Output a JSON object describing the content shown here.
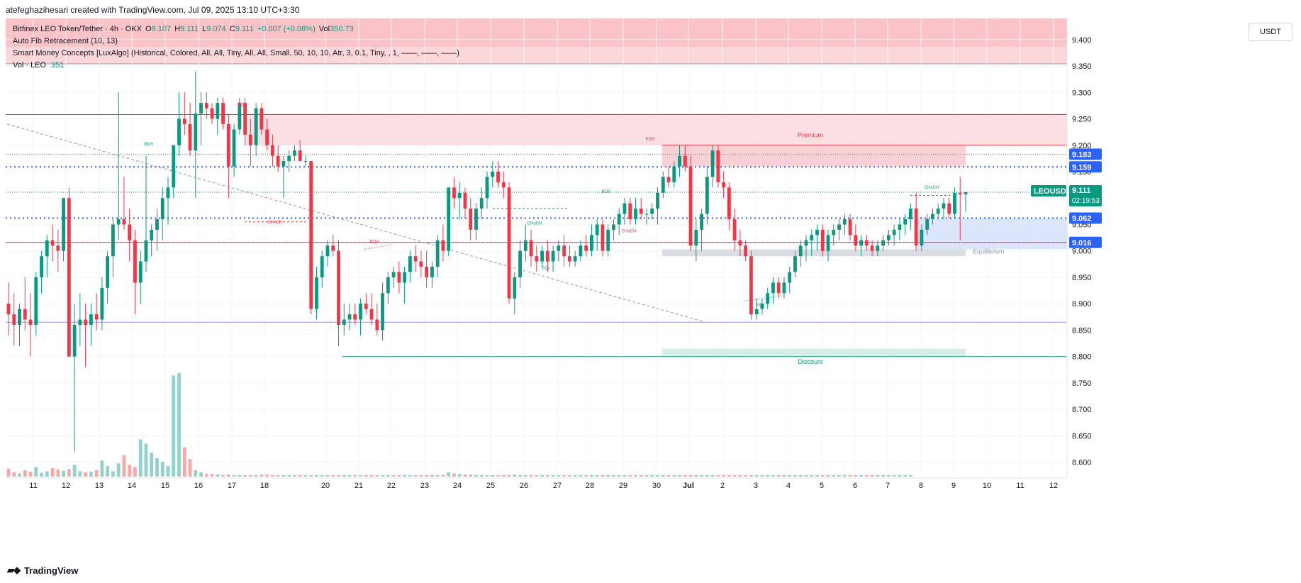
{
  "header": {
    "credit": "atefeghazihesari created with TradingView.com, Jul 09, 2025 13:10 UTC+3:30"
  },
  "legend": {
    "symbol_line": {
      "name": "Bitfinex LEO Token/Tether · 4h · OKX",
      "o_label": "O",
      "o": "9.107",
      "h_label": "H",
      "h": "9.111",
      "l_label": "L",
      "l": "9.074",
      "c_label": "C",
      "c": "9.111",
      "change": "+0.007 (+0.08%)",
      "vol_label": "Vol",
      "vol": "350.73"
    },
    "fib_line": "Auto Fib Retracement (10, 13)",
    "smc_line": "Smart Money Concepts [LuxAlgo] (Historical, Colored, All, All, Tiny, All, All, Small, 50, 10, 10, Atr, 3, 0.1, Tiny, , 1, ——, ——, ——)",
    "vol_line": {
      "label": "Vol · LEO",
      "value": "351"
    }
  },
  "currency_button": "USDT",
  "footer": {
    "logo": "TradingView"
  },
  "colors": {
    "up": "#089981",
    "down": "#f23645",
    "blue": "#2962ff",
    "grid": "#f0f3fa",
    "premium": "#fbdcdf",
    "discount": "#d6eee9"
  },
  "chart_data": {
    "type": "candlestick",
    "symbol": "LEOUSDT",
    "timeframe": "4h",
    "ylim": [
      8.57,
      9.44
    ],
    "y_ticks": [
      "9.400",
      "9.350",
      "9.300",
      "9.250",
      "9.200",
      "9.150",
      "9.100",
      "9.050",
      "9.000",
      "8.950",
      "8.900",
      "8.850",
      "8.800",
      "8.750",
      "8.700",
      "8.650",
      "8.600"
    ],
    "x_ticks": [
      "11",
      "12",
      "13",
      "14",
      "15",
      "16",
      "17",
      "18",
      "20",
      "21",
      "22",
      "23",
      "24",
      "25",
      "26",
      "27",
      "28",
      "29",
      "30",
      "Jul",
      "2",
      "3",
      "4",
      "5",
      "6",
      "7",
      "8",
      "9",
      "10",
      "11",
      "12"
    ],
    "price_labels": [
      {
        "text": "9.183",
        "value": 9.183,
        "color": "#2962ff"
      },
      {
        "text": "9.159",
        "value": 9.159,
        "color": "#2962ff"
      },
      {
        "text": "LEOUSDT",
        "value": 9.111,
        "color": "#089981"
      },
      {
        "text": "9.111",
        "value": 9.111,
        "color": "#089981"
      },
      {
        "text": "02:19:53",
        "value": 9.111,
        "color": "#089981"
      },
      {
        "text": "9.062",
        "value": 9.062,
        "color": "#2962ff"
      },
      {
        "text": "9.016",
        "value": 9.016,
        "color": "#2962ff"
      }
    ],
    "zones": [
      {
        "name": "Premium",
        "from": 9.2,
        "to": 9.26
      },
      {
        "name": "Equilibrium",
        "from": 8.99,
        "to": 9.003
      },
      {
        "name": "Discount",
        "from": 8.8,
        "to": 8.815
      }
    ],
    "structure_labels": [
      "BOS",
      "EQH",
      "CHoCH",
      "EQH",
      "EQL",
      "BOS",
      "CHoCH",
      "CHoCH",
      "EQH",
      "EQL",
      "CHoCH"
    ],
    "last_close": 9.111,
    "candles": [
      [
        8.9,
        8.94,
        8.84,
        8.88
      ],
      [
        8.88,
        8.92,
        8.82,
        8.86
      ],
      [
        8.86,
        8.9,
        8.82,
        8.89
      ],
      [
        8.89,
        8.95,
        8.85,
        8.87
      ],
      [
        8.87,
        8.92,
        8.8,
        8.86
      ],
      [
        8.86,
        8.96,
        8.84,
        8.95
      ],
      [
        8.95,
        9.0,
        8.92,
        8.99
      ],
      [
        8.99,
        9.03,
        8.95,
        9.02
      ],
      [
        9.02,
        9.05,
        8.98,
        9.01
      ],
      [
        9.01,
        9.04,
        8.96,
        9.0
      ],
      [
        9.0,
        9.1,
        8.98,
        9.1
      ],
      [
        9.1,
        9.12,
        8.98,
        8.8
      ],
      [
        8.8,
        8.9,
        8.62,
        8.86
      ],
      [
        8.86,
        8.92,
        8.82,
        8.87
      ],
      [
        8.87,
        8.9,
        8.78,
        8.86
      ],
      [
        8.86,
        8.9,
        8.82,
        8.88
      ],
      [
        8.88,
        8.92,
        8.85,
        8.87
      ],
      [
        8.87,
        8.95,
        8.85,
        8.93
      ],
      [
        8.93,
        9.0,
        8.9,
        8.99
      ],
      [
        8.99,
        9.06,
        8.95,
        9.05
      ],
      [
        9.05,
        9.3,
        9.02,
        9.06
      ],
      [
        9.06,
        9.14,
        9.04,
        9.05
      ],
      [
        9.05,
        9.08,
        8.98,
        9.02
      ],
      [
        9.02,
        9.04,
        8.88,
        8.94
      ],
      [
        8.94,
        9.0,
        8.9,
        8.98
      ],
      [
        8.98,
        9.18,
        8.96,
        9.02
      ],
      [
        9.02,
        9.05,
        8.99,
        9.04
      ],
      [
        9.04,
        9.08,
        9.0,
        9.06
      ],
      [
        9.06,
        9.12,
        9.02,
        9.1
      ],
      [
        9.1,
        9.14,
        9.05,
        9.12
      ],
      [
        9.12,
        9.2,
        9.1,
        9.2
      ],
      [
        9.2,
        9.3,
        9.18,
        9.25
      ],
      [
        9.25,
        9.3,
        9.22,
        9.24
      ],
      [
        9.24,
        9.28,
        9.18,
        9.19
      ],
      [
        9.19,
        9.34,
        9.1,
        9.26
      ],
      [
        9.26,
        9.3,
        9.2,
        9.28
      ],
      [
        9.28,
        9.3,
        9.25,
        9.27
      ],
      [
        9.27,
        9.28,
        9.24,
        9.25
      ],
      [
        9.25,
        9.29,
        9.22,
        9.28
      ],
      [
        9.28,
        9.29,
        9.23,
        9.24
      ],
      [
        9.24,
        9.26,
        9.1,
        9.16
      ],
      [
        9.16,
        9.24,
        9.14,
        9.23
      ],
      [
        9.23,
        9.29,
        9.22,
        9.28
      ],
      [
        9.28,
        9.29,
        9.2,
        9.22
      ],
      [
        9.22,
        9.25,
        9.16,
        9.2
      ],
      [
        9.2,
        9.28,
        9.18,
        9.27
      ],
      [
        9.27,
        9.28,
        9.22,
        9.23
      ],
      [
        9.23,
        9.25,
        9.19,
        9.2
      ],
      [
        9.2,
        9.22,
        9.16,
        9.18
      ],
      [
        9.18,
        9.2,
        9.15,
        9.16
      ],
      [
        9.16,
        9.18,
        9.1,
        9.17
      ],
      [
        9.17,
        9.19,
        9.15,
        9.18
      ],
      [
        9.18,
        9.2,
        9.17,
        9.19
      ],
      [
        9.19,
        9.21,
        9.17,
        9.17
      ],
      [
        9.17,
        9.18,
        9.16,
        9.17
      ],
      [
        9.17,
        9.17,
        8.88,
        8.89
      ],
      [
        8.89,
        8.97,
        8.87,
        8.95
      ],
      [
        8.95,
        9.0,
        8.93,
        8.99
      ],
      [
        8.99,
        9.02,
        8.97,
        9.01
      ],
      [
        9.01,
        9.03,
        8.99,
        9.0
      ],
      [
        9.0,
        9.02,
        8.82,
        8.86
      ],
      [
        8.86,
        8.9,
        8.84,
        8.87
      ],
      [
        8.87,
        8.9,
        8.85,
        8.88
      ],
      [
        8.88,
        8.9,
        8.86,
        8.87
      ],
      [
        8.87,
        8.91,
        8.84,
        8.9
      ],
      [
        8.9,
        8.92,
        8.88,
        8.89
      ],
      [
        8.89,
        8.92,
        8.86,
        8.87
      ],
      [
        8.87,
        8.9,
        8.84,
        8.85
      ],
      [
        8.85,
        8.94,
        8.83,
        8.92
      ],
      [
        8.92,
        8.96,
        8.9,
        8.95
      ],
      [
        8.95,
        8.97,
        8.93,
        8.96
      ],
      [
        8.96,
        8.98,
        8.92,
        8.94
      ],
      [
        8.94,
        8.97,
        8.9,
        8.96
      ],
      [
        8.96,
        9.0,
        8.94,
        8.99
      ],
      [
        8.99,
        9.01,
        8.96,
        8.98
      ],
      [
        8.98,
        9.0,
        8.95,
        8.97
      ],
      [
        8.97,
        9.0,
        8.93,
        8.95
      ],
      [
        8.95,
        8.98,
        8.93,
        8.97
      ],
      [
        8.97,
        9.03,
        8.95,
        9.02
      ],
      [
        9.02,
        9.05,
        8.98,
        9.0
      ],
      [
        9.0,
        9.12,
        8.99,
        9.12
      ],
      [
        9.12,
        9.14,
        9.08,
        9.1
      ],
      [
        9.1,
        9.13,
        9.06,
        9.11
      ],
      [
        9.11,
        9.12,
        9.06,
        9.08
      ],
      [
        9.08,
        9.1,
        9.02,
        9.04
      ],
      [
        9.04,
        9.09,
        9.02,
        9.08
      ],
      [
        9.08,
        9.12,
        9.06,
        9.1
      ],
      [
        9.1,
        9.15,
        9.08,
        9.14
      ],
      [
        9.14,
        9.17,
        9.12,
        9.15
      ],
      [
        9.15,
        9.17,
        9.12,
        9.13
      ],
      [
        9.13,
        9.15,
        9.1,
        9.12
      ],
      [
        9.12,
        9.13,
        8.9,
        8.91
      ],
      [
        8.91,
        8.96,
        8.88,
        8.95
      ],
      [
        8.95,
        9.02,
        8.93,
        9.0
      ],
      [
        9.0,
        9.05,
        8.98,
        9.02
      ],
      [
        9.02,
        9.04,
        8.97,
        8.99
      ],
      [
        8.99,
        9.01,
        8.96,
        8.98
      ],
      [
        8.98,
        9.01,
        8.97,
        9.0
      ],
      [
        9.0,
        9.02,
        8.96,
        8.98
      ],
      [
        8.98,
        9.01,
        8.96,
        9.0
      ],
      [
        9.0,
        9.02,
        8.98,
        9.01
      ],
      [
        9.01,
        9.03,
        8.97,
        8.99
      ],
      [
        8.99,
        9.01,
        8.97,
        8.98
      ],
      [
        8.98,
        9.0,
        8.97,
        8.99
      ],
      [
        8.99,
        9.02,
        8.98,
        9.01
      ],
      [
        9.01,
        9.03,
        8.99,
        9.0
      ],
      [
        9.0,
        9.05,
        8.99,
        9.03
      ],
      [
        9.03,
        9.06,
        9.0,
        9.05
      ],
      [
        9.05,
        9.06,
        8.99,
        9.0
      ],
      [
        9.0,
        9.05,
        8.99,
        9.04
      ],
      [
        9.04,
        9.06,
        9.02,
        9.05
      ],
      [
        9.05,
        9.08,
        9.03,
        9.07
      ],
      [
        9.07,
        9.1,
        9.05,
        9.09
      ],
      [
        9.09,
        9.1,
        9.05,
        9.06
      ],
      [
        9.06,
        9.1,
        9.05,
        9.08
      ],
      [
        9.08,
        9.1,
        9.06,
        9.07
      ],
      [
        9.07,
        9.08,
        9.05,
        9.07
      ],
      [
        9.07,
        9.09,
        9.06,
        9.08
      ],
      [
        9.08,
        9.12,
        9.05,
        9.11
      ],
      [
        9.11,
        9.15,
        9.1,
        9.14
      ],
      [
        9.14,
        9.16,
        9.12,
        9.13
      ],
      [
        9.13,
        9.17,
        9.12,
        9.16
      ],
      [
        9.16,
        9.2,
        9.14,
        9.18
      ],
      [
        9.18,
        9.2,
        9.15,
        9.16
      ],
      [
        9.16,
        9.18,
        9.0,
        9.01
      ],
      [
        9.01,
        9.06,
        8.98,
        9.04
      ],
      [
        9.04,
        9.08,
        9.0,
        9.07
      ],
      [
        9.07,
        9.16,
        9.05,
        9.14
      ],
      [
        9.14,
        9.2,
        9.12,
        9.19
      ],
      [
        9.19,
        9.2,
        9.12,
        9.13
      ],
      [
        9.13,
        9.15,
        9.1,
        9.12
      ],
      [
        9.12,
        9.13,
        9.04,
        9.06
      ],
      [
        9.06,
        9.08,
        9.0,
        9.02
      ],
      [
        9.02,
        9.04,
        8.99,
        9.01
      ],
      [
        9.01,
        9.02,
        8.98,
        8.99
      ],
      [
        8.99,
        9.0,
        8.87,
        8.88
      ],
      [
        8.88,
        8.91,
        8.87,
        8.89
      ],
      [
        8.89,
        8.91,
        8.88,
        8.9
      ],
      [
        8.9,
        8.93,
        8.89,
        8.92
      ],
      [
        8.92,
        8.95,
        8.9,
        8.94
      ],
      [
        8.94,
        8.95,
        8.91,
        8.92
      ],
      [
        8.92,
        8.95,
        8.91,
        8.94
      ],
      [
        8.94,
        8.97,
        8.92,
        8.96
      ],
      [
        8.96,
        9.0,
        8.95,
        8.99
      ],
      [
        8.99,
        9.02,
        8.97,
        9.01
      ],
      [
        9.01,
        9.03,
        8.98,
        9.02
      ],
      [
        9.02,
        9.04,
        8.99,
        9.03
      ],
      [
        9.03,
        9.05,
        9.0,
        9.04
      ],
      [
        9.04,
        9.05,
        8.99,
        9.0
      ],
      [
        9.0,
        9.04,
        8.98,
        9.03
      ],
      [
        9.03,
        9.05,
        9.01,
        9.04
      ],
      [
        9.04,
        9.06,
        9.02,
        9.05
      ],
      [
        9.05,
        9.07,
        9.03,
        9.06
      ],
      [
        9.06,
        9.07,
        9.02,
        9.03
      ],
      [
        9.03,
        9.05,
        9.0,
        9.01
      ],
      [
        9.01,
        9.03,
        8.99,
        9.02
      ],
      [
        9.02,
        9.03,
        9.0,
        9.01
      ],
      [
        9.01,
        9.02,
        8.99,
        9.0
      ],
      [
        9.0,
        9.02,
        8.99,
        9.01
      ],
      [
        9.01,
        9.03,
        9.0,
        9.02
      ],
      [
        9.02,
        9.04,
        9.01,
        9.03
      ],
      [
        9.03,
        9.05,
        9.01,
        9.04
      ],
      [
        9.04,
        9.06,
        9.02,
        9.05
      ],
      [
        9.05,
        9.07,
        9.03,
        9.06
      ],
      [
        9.06,
        9.09,
        9.04,
        9.08
      ],
      [
        9.08,
        9.11,
        9.0,
        9.01
      ],
      [
        9.01,
        9.05,
        9.0,
        9.04
      ],
      [
        9.04,
        9.07,
        9.03,
        9.06
      ],
      [
        9.06,
        9.08,
        9.05,
        9.07
      ],
      [
        9.07,
        9.09,
        9.06,
        9.08
      ],
      [
        9.08,
        9.1,
        9.06,
        9.09
      ],
      [
        9.09,
        9.1,
        9.06,
        9.07
      ],
      [
        9.07,
        9.12,
        9.06,
        9.11
      ],
      [
        9.11,
        9.14,
        9.02,
        9.107
      ],
      [
        9.107,
        9.111,
        9.074,
        9.111
      ]
    ],
    "volumes": [
      15,
      8,
      6,
      12,
      9,
      18,
      7,
      10,
      16,
      13,
      11,
      14,
      22,
      10,
      8,
      9,
      12,
      30,
      20,
      10,
      25,
      40,
      22,
      18,
      70,
      62,
      45,
      35,
      28,
      20,
      190,
      195,
      55,
      33,
      12,
      8,
      5,
      5,
      4,
      3,
      4,
      3,
      3,
      3,
      3,
      3,
      4,
      4,
      3,
      3,
      3,
      3,
      3,
      3,
      3,
      3,
      3,
      3,
      3,
      3,
      3,
      3,
      3,
      3,
      3,
      3,
      3,
      3,
      3,
      3,
      3,
      3,
      3,
      3,
      3,
      3,
      3,
      3,
      3,
      3,
      8,
      6,
      5,
      4,
      4,
      3,
      3,
      3,
      3,
      3,
      3,
      3,
      4,
      3,
      3,
      3,
      3,
      3,
      3,
      3,
      3,
      3,
      3,
      3,
      3,
      3,
      3,
      3,
      3,
      3,
      3,
      3,
      3,
      3,
      3,
      3,
      3,
      3,
      3,
      3,
      3,
      3,
      3,
      3,
      3,
      3,
      3,
      3,
      3,
      3,
      3,
      3,
      3,
      3,
      3,
      3,
      3,
      3,
      3,
      3,
      3,
      3,
      3,
      3,
      3,
      3,
      3,
      3,
      3,
      3,
      3,
      3,
      3,
      3,
      3,
      3,
      3,
      3,
      3,
      3,
      3,
      3,
      3,
      3,
      3
    ]
  }
}
